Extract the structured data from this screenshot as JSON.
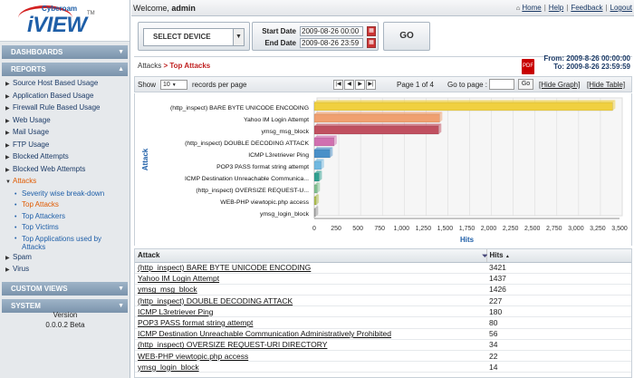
{
  "logo": {
    "brand": "Cyberoam",
    "product": "iVIEW",
    "tm": "TM"
  },
  "sidebar": {
    "sections": {
      "dashboards": "DASHBOARDS",
      "reports": "REPORTS",
      "custom_views": "CUSTOM VIEWS",
      "system": "SYSTEM"
    },
    "items": [
      "Source Host Based Usage",
      "Application Based Usage",
      "Firewall Rule Based Usage",
      "Web Usage",
      "Mail Usage",
      "FTP Usage",
      "Blocked Attempts",
      "Blocked Web Attempts",
      "Attacks"
    ],
    "sub_items": [
      "Severity wise break-down",
      "Top Attacks",
      "Top Attackers",
      "Top Victims",
      "Top Applications used by Attacks"
    ],
    "after_items": [
      "Spam",
      "Virus"
    ],
    "version_label": "Version",
    "version_number": "0.0.0.2 Beta"
  },
  "topbar": {
    "welcome_prefix": "Welcome, ",
    "user": "admin",
    "links": [
      "Home",
      "Help",
      "Feedback",
      "Logout"
    ]
  },
  "filter": {
    "device_select": "SELECT DEVICE",
    "start_label": "Start Date",
    "start_value": "2009-08-26 00:00",
    "end_label": "End Date",
    "end_value": "2009-08-26 23:59",
    "go_label": "GO"
  },
  "breadcrumb": {
    "parent": "Attacks",
    "sep": " > ",
    "current": "Top Attacks"
  },
  "range": {
    "from_label": "From:",
    "from_value": "2009-8-26 00:00:00",
    "to_label": "To:",
    "to_value": "2009-8-26 23:59:59"
  },
  "pager": {
    "show_label": "Show",
    "per_page": "10",
    "per_page_label": "records per page",
    "page_info": "Page 1 of 4",
    "goto_label": "Go to page :",
    "go_btn": "Go",
    "hide_graph": "[Hide Graph]",
    "hide_table": "[Hide Table]"
  },
  "chart_data": {
    "type": "bar",
    "orientation": "horizontal",
    "xlabel": "Hits",
    "ylabel": "Attack",
    "xlim": [
      0,
      3500
    ],
    "xticks": [
      0,
      250,
      500,
      750,
      1000,
      1250,
      1500,
      1750,
      2000,
      2250,
      2500,
      2750,
      3000,
      3250,
      3500
    ],
    "categories": [
      "(http_inspect) BARE BYTE UNICODE ENCODING",
      "Yahoo IM Login Attempt",
      "ymsg_msg_block",
      "(http_inspect) DOUBLE DECODING ATTACK",
      "ICMP L3retriever Ping",
      "POP3 PASS format string attempt",
      "ICMP Destination Unreachable Communica...",
      "(http_inspect) OVERSIZE REQUEST-U...",
      "WEB-PHP viewtopic.php access",
      "ymsg_login_block"
    ],
    "values": [
      3421,
      1437,
      1426,
      227,
      180,
      80,
      56,
      34,
      22,
      14
    ],
    "colors": [
      "#f0d040",
      "#f0a070",
      "#c05060",
      "#d070b0",
      "#4a90c8",
      "#70b8e0",
      "#30a090",
      "#80c090",
      "#b0c050",
      "#a0a0a0"
    ]
  },
  "table": {
    "headers": {
      "attack": "Attack",
      "hits": "Hits",
      "sort_glyph": "▲"
    },
    "rows": [
      {
        "attack": "(http_inspect) BARE BYTE UNICODE ENCODING",
        "hits": "3421"
      },
      {
        "attack": "Yahoo IM Login Attempt",
        "hits": "1437"
      },
      {
        "attack": "ymsg_msg_block",
        "hits": "1426"
      },
      {
        "attack": "(http_inspect) DOUBLE DECODING ATTACK",
        "hits": "227"
      },
      {
        "attack": "ICMP L3retriever Ping",
        "hits": "180"
      },
      {
        "attack": "POP3 PASS format string attempt",
        "hits": "80"
      },
      {
        "attack": "ICMP Destination Unreachable Communication Administratively Prohibited",
        "hits": "56"
      },
      {
        "attack": "(http_inspect) OVERSIZE REQUEST-URI DIRECTORY",
        "hits": "34"
      },
      {
        "attack": "WEB-PHP viewtopic.php access",
        "hits": "22"
      },
      {
        "attack": "ymsg_login_block",
        "hits": "14"
      }
    ]
  }
}
